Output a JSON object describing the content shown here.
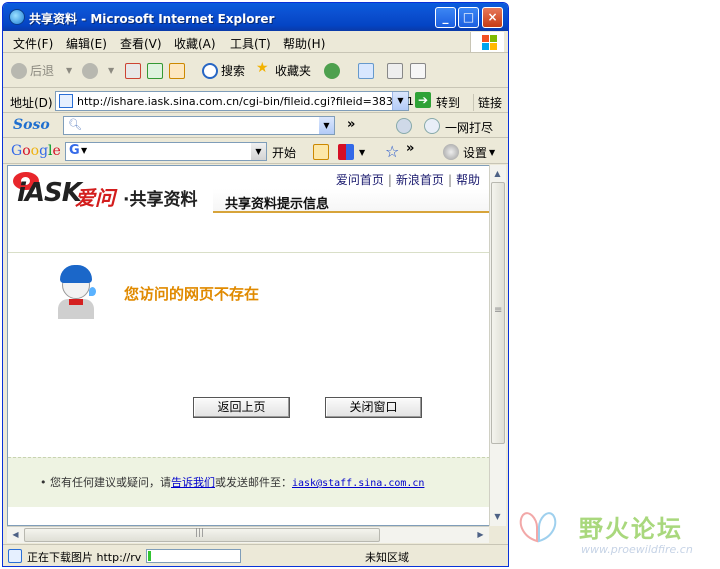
{
  "window": {
    "title": "共享资料 - Microsoft Internet Explorer"
  },
  "menu": [
    "文件(F)",
    "编辑(E)",
    "查看(V)",
    "收藏(A)",
    "工具(T)",
    "帮助(H)"
  ],
  "toolbar": {
    "back": "后退",
    "search": "搜索",
    "favorites": "收藏夹"
  },
  "address": {
    "label": "地址(D)",
    "url": "http://ishare.iask.sina.com.cn/cgi-bin/fileid.cgi?fileid=3831611",
    "go": "转到",
    "links": "链接"
  },
  "soso": {
    "logo": "Soso",
    "right_label": "一网打尽"
  },
  "google": {
    "logo": "Google",
    "start": "开始",
    "settings": "设置"
  },
  "page": {
    "nav": [
      "爱问首页",
      "新浪首页",
      "帮助"
    ],
    "logo_iask": "iASK",
    "logo_aiwen": "爱问",
    "logo_sub": "·共享资料",
    "heading": "共享资料提示信息",
    "message": "您访问的网页不存在",
    "back_button": "返回上页",
    "close_button": "关闭窗口",
    "footer_prefix": "• 您有任何建议或疑问，请",
    "footer_link": "告诉我们",
    "footer_middle": "或发送邮件至：",
    "footer_email": "iask@staff.sina.com.cn"
  },
  "status": {
    "text": "正在下载图片 http://rv",
    "zone": "未知区域",
    "progress": 0.03
  },
  "watermark": {
    "title": "野火论坛",
    "url": "www.proewildfire.cn"
  },
  "colors": {
    "title_bar": "#0a5ddd",
    "message": "#e08a00",
    "heading_underline": "#d7a43a",
    "aiwen_red": "#d31d1d"
  }
}
